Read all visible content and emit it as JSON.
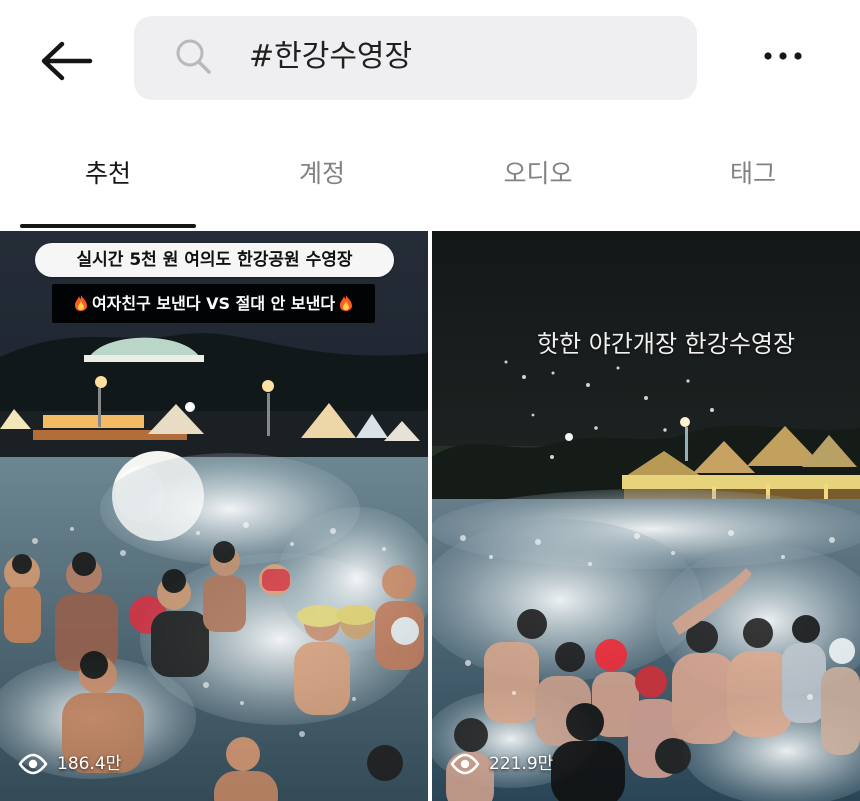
{
  "search": {
    "query": "#한강수영장"
  },
  "tabs": [
    {
      "label": "추천",
      "active": true
    },
    {
      "label": "계정",
      "active": false
    },
    {
      "label": "오디오",
      "active": false
    },
    {
      "label": "태그",
      "active": false
    }
  ],
  "results": [
    {
      "caption_line_1": "실시간 5천 원 여의도 한강공원 수영장",
      "caption_line_2": "여자친구 보낸다 VS 절대 안 보낸다",
      "views": "186.4만"
    },
    {
      "caption_line_1": "핫한 야간개장 한강수영장",
      "views": "221.9만"
    }
  ],
  "icons": {
    "back": "arrow-left-icon",
    "search": "search-icon",
    "more": "more-icon",
    "views": "eye-icon",
    "fire": "fire-icon"
  },
  "colors": {
    "search_background": "#efeff1",
    "active_text": "#171717",
    "inactive_text": "#828282",
    "indicator": "#161616"
  }
}
